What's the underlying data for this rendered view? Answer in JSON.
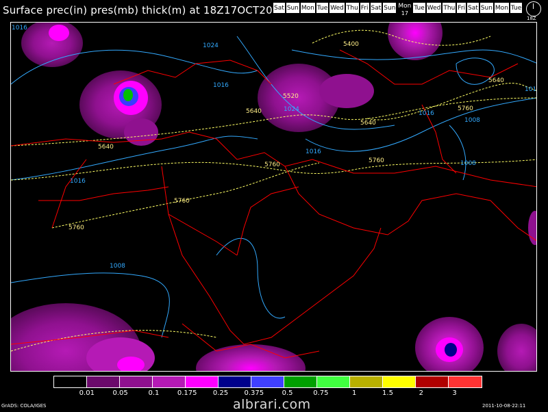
{
  "title": "Surface prec(in) pres(mb) thick(m) at 18Z17OCT2011",
  "day_strip": {
    "days": [
      "Sat",
      "Sun",
      "Mon",
      "Tue",
      "Wed",
      "Thu",
      "Fri",
      "Sat",
      "Sun",
      "Mon",
      "Tue",
      "Wed",
      "Thu",
      "Fri",
      "Sat",
      "Sun",
      "Mon",
      "Tue"
    ],
    "current_index": 9,
    "current_day_number": "17"
  },
  "clock_label": "18Z",
  "legend": {
    "colors": [
      "#000000",
      "#6b0a6b",
      "#8f118f",
      "#b51ab5",
      "#ff00ff",
      "#00008b",
      "#4040ff",
      "#00a000",
      "#40ff40",
      "#b8b000",
      "#ffff00",
      "#b00000",
      "#ff3333"
    ],
    "tick_labels": [
      "0.01",
      "0.05",
      "0.1",
      "0.175",
      "0.25",
      "0.375",
      "0.5",
      "0.75",
      "1",
      "1.5",
      "2",
      "3"
    ]
  },
  "contour_labels": {
    "pressure": [
      "1016",
      "1024",
      "1016",
      "1024",
      "1016",
      "1016",
      "1008",
      "1008",
      "1016",
      "1016",
      "1008"
    ],
    "thickness": [
      "5400",
      "5520",
      "5640",
      "5640",
      "5640",
      "5760",
      "5760",
      "5760",
      "5760",
      "5760",
      "5640"
    ]
  },
  "colors": {
    "pressure_contour": "#33aaff",
    "thickness_contour": "#ffff66",
    "borders": "#ff0000",
    "precip_light": "#8f118f",
    "precip_heavy": "#ff00ff"
  },
  "footer": {
    "left": "GrADS: COLA/IGES",
    "right": "2011-10-08-22:11"
  },
  "watermark": "albrari.com"
}
